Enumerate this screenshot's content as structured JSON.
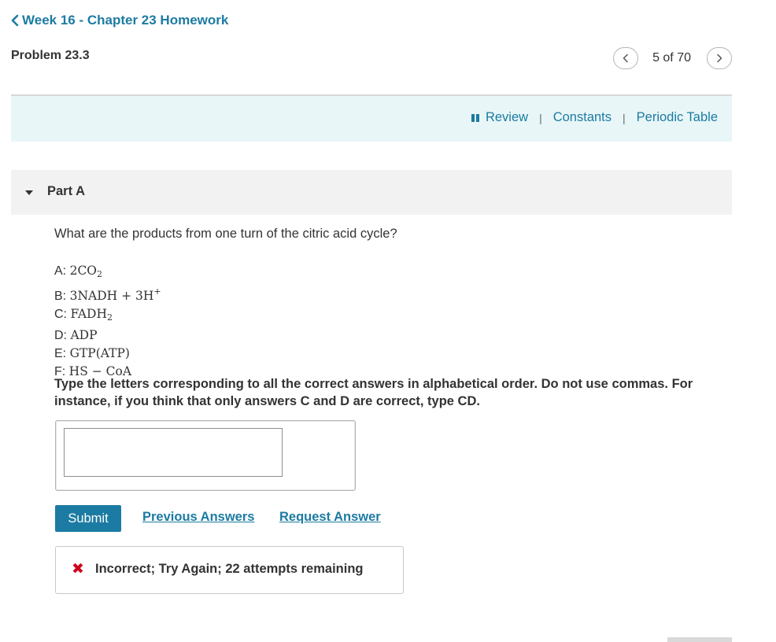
{
  "breadcrumb": {
    "icon": "chevron-left-icon",
    "label": "Week 16 - Chapter 23 Homework"
  },
  "problem": {
    "title": "Problem 23.3"
  },
  "pager": {
    "count": "5 of 70",
    "prev_icon": "chevron-left-icon",
    "next_icon": "chevron-right-icon"
  },
  "resources": {
    "icon": "book-icon",
    "review": "Review",
    "separator": "|",
    "constants": "Constants",
    "periodic_table": "Periodic Table"
  },
  "part": {
    "label": "Part A",
    "icon": "caret-down-icon"
  },
  "question": "What are the products from one turn of the citric acid cycle?",
  "options": [
    {
      "letter": "A:",
      "text": "2CO",
      "sub": "2"
    },
    {
      "letter": "B:",
      "text": "3NADH + 3H",
      "sup": "+"
    },
    {
      "letter": "C:",
      "text": "FADH",
      "sub": "2"
    },
    {
      "letter": "D:",
      "text": "ADP"
    },
    {
      "letter": "E:",
      "text": "GTP(ATP)"
    },
    {
      "letter": "F:",
      "text": "HS − CoA"
    }
  ],
  "instructions": "Type the letters corresponding to all the correct answers in alphabetical order. Do not use commas. For instance, if you think that only answers C and D are correct, type CD.",
  "answer": {
    "value": ""
  },
  "actions": {
    "submit": "Submit",
    "previous_answers": "Previous Answers",
    "request_answer": "Request Answer"
  },
  "feedback": {
    "icon": "x-mark-icon",
    "mark": "✖",
    "message": "Incorrect; Try Again; 22 attempts remaining"
  },
  "colors": {
    "link": "#1c7ba2",
    "resource_bar_bg": "#e8f6f8",
    "part_header_bg": "#f2f2f2",
    "error": "#d0021b"
  }
}
